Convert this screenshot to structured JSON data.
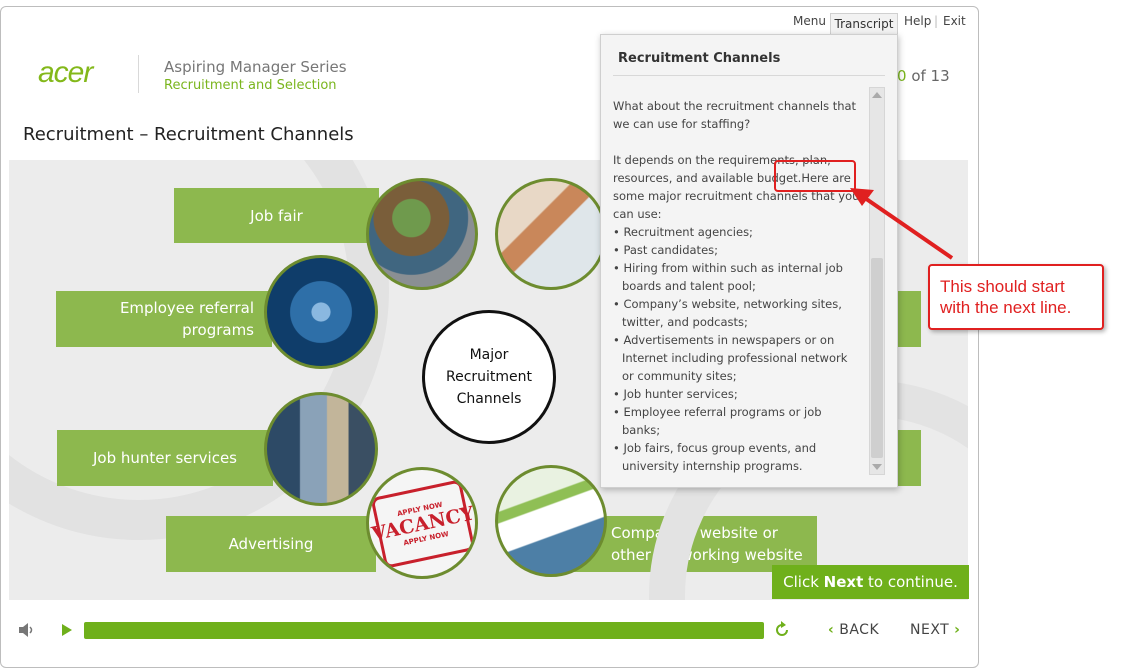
{
  "header": {
    "logo": "acer",
    "series": "Aspiring Manager Series",
    "course": "Recruitment and Selection",
    "menu_label": "Menu",
    "transcript_label": "Transcript",
    "help_label": "Help",
    "exit_label": "Exit",
    "page_current": "0",
    "page_of": "of 13"
  },
  "page_title": "Recruitment – Recruitment Channels",
  "diagram": {
    "center_lines": [
      "Major",
      "Recruitment",
      "Channels"
    ],
    "channels": [
      {
        "label": "Job fair",
        "icon": "job-fair-photo"
      },
      {
        "label": "Employee referral programs",
        "label_line1": "Employee referral",
        "label_line2": "programs",
        "icon": "network-globe-photo"
      },
      {
        "label": "Job hunter services",
        "icon": "job-hunter-photo"
      },
      {
        "label": "Advertising",
        "icon": "vacancy-stamp-photo"
      },
      {
        "label": "Company’s website or other networking website",
        "label_line1": "Company’s website or",
        "label_line2": "other networking website",
        "icon": "website-photo"
      }
    ],
    "stamp_top": "APPLY NOW",
    "stamp_main": "VACANCY",
    "stamp_bottom": "APPLY NOW"
  },
  "continue": {
    "prefix": "Click ",
    "bold": "Next",
    "suffix": " to continue."
  },
  "transcript": {
    "title": "Recruitment Channels",
    "question": "What about the recruitment channels that we can use for staffing?",
    "answer_lines": [
      "It depends on the requirements, plan,",
      "resources, and available budget.Here are",
      "some major recruitment channels that you",
      "can use:"
    ],
    "items": [
      "• Recruitment agencies;",
      "• Past candidates;",
      "• Hiring from within such as internal job boards and talent pool;",
      "• Company’s website, networking sites, twitter, and podcasts;",
      "• Advertisements in newspapers or on Internet including professional network or community sites;",
      "• Job hunter services;",
      "• Employee referral programs or job banks;",
      "• Job fairs, focus group events, and university internship programs."
    ]
  },
  "annotation": {
    "line1": "This should start",
    "line2": "with  the next line."
  },
  "player": {
    "back_label": "BACK",
    "next_label": "NEXT",
    "progress": 1.0
  },
  "colors": {
    "brand_green": "#7ab51d",
    "bar_green": "#8db84e",
    "annotation_red": "#e02020"
  }
}
